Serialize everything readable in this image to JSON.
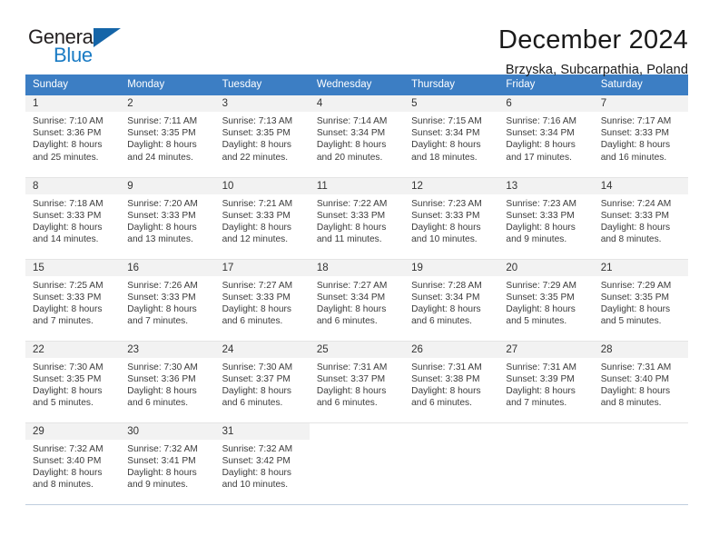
{
  "brand": {
    "name_part1": "General",
    "name_part2": "Blue",
    "triangle_color": "#1565a8",
    "blue_color": "#1a7bc4"
  },
  "header": {
    "title": "December 2024",
    "location": "Brzyska, Subcarpathia, Poland"
  },
  "theme": {
    "header_bg": "#3c7ec4",
    "daynum_bg": "#f2f2f2",
    "row_divider": "#e4e4e4",
    "table_rule": "#bfcede"
  },
  "weekday_headers": [
    "Sunday",
    "Monday",
    "Tuesday",
    "Wednesday",
    "Thursday",
    "Friday",
    "Saturday"
  ],
  "weeks": [
    [
      {
        "day": "1",
        "sunrise": "Sunrise: 7:10 AM",
        "sunset": "Sunset: 3:36 PM",
        "daylight1": "Daylight: 8 hours",
        "daylight2": "and 25 minutes."
      },
      {
        "day": "2",
        "sunrise": "Sunrise: 7:11 AM",
        "sunset": "Sunset: 3:35 PM",
        "daylight1": "Daylight: 8 hours",
        "daylight2": "and 24 minutes."
      },
      {
        "day": "3",
        "sunrise": "Sunrise: 7:13 AM",
        "sunset": "Sunset: 3:35 PM",
        "daylight1": "Daylight: 8 hours",
        "daylight2": "and 22 minutes."
      },
      {
        "day": "4",
        "sunrise": "Sunrise: 7:14 AM",
        "sunset": "Sunset: 3:34 PM",
        "daylight1": "Daylight: 8 hours",
        "daylight2": "and 20 minutes."
      },
      {
        "day": "5",
        "sunrise": "Sunrise: 7:15 AM",
        "sunset": "Sunset: 3:34 PM",
        "daylight1": "Daylight: 8 hours",
        "daylight2": "and 18 minutes."
      },
      {
        "day": "6",
        "sunrise": "Sunrise: 7:16 AM",
        "sunset": "Sunset: 3:34 PM",
        "daylight1": "Daylight: 8 hours",
        "daylight2": "and 17 minutes."
      },
      {
        "day": "7",
        "sunrise": "Sunrise: 7:17 AM",
        "sunset": "Sunset: 3:33 PM",
        "daylight1": "Daylight: 8 hours",
        "daylight2": "and 16 minutes."
      }
    ],
    [
      {
        "day": "8",
        "sunrise": "Sunrise: 7:18 AM",
        "sunset": "Sunset: 3:33 PM",
        "daylight1": "Daylight: 8 hours",
        "daylight2": "and 14 minutes."
      },
      {
        "day": "9",
        "sunrise": "Sunrise: 7:20 AM",
        "sunset": "Sunset: 3:33 PM",
        "daylight1": "Daylight: 8 hours",
        "daylight2": "and 13 minutes."
      },
      {
        "day": "10",
        "sunrise": "Sunrise: 7:21 AM",
        "sunset": "Sunset: 3:33 PM",
        "daylight1": "Daylight: 8 hours",
        "daylight2": "and 12 minutes."
      },
      {
        "day": "11",
        "sunrise": "Sunrise: 7:22 AM",
        "sunset": "Sunset: 3:33 PM",
        "daylight1": "Daylight: 8 hours",
        "daylight2": "and 11 minutes."
      },
      {
        "day": "12",
        "sunrise": "Sunrise: 7:23 AM",
        "sunset": "Sunset: 3:33 PM",
        "daylight1": "Daylight: 8 hours",
        "daylight2": "and 10 minutes."
      },
      {
        "day": "13",
        "sunrise": "Sunrise: 7:23 AM",
        "sunset": "Sunset: 3:33 PM",
        "daylight1": "Daylight: 8 hours",
        "daylight2": "and 9 minutes."
      },
      {
        "day": "14",
        "sunrise": "Sunrise: 7:24 AM",
        "sunset": "Sunset: 3:33 PM",
        "daylight1": "Daylight: 8 hours",
        "daylight2": "and 8 minutes."
      }
    ],
    [
      {
        "day": "15",
        "sunrise": "Sunrise: 7:25 AM",
        "sunset": "Sunset: 3:33 PM",
        "daylight1": "Daylight: 8 hours",
        "daylight2": "and 7 minutes."
      },
      {
        "day": "16",
        "sunrise": "Sunrise: 7:26 AM",
        "sunset": "Sunset: 3:33 PM",
        "daylight1": "Daylight: 8 hours",
        "daylight2": "and 7 minutes."
      },
      {
        "day": "17",
        "sunrise": "Sunrise: 7:27 AM",
        "sunset": "Sunset: 3:33 PM",
        "daylight1": "Daylight: 8 hours",
        "daylight2": "and 6 minutes."
      },
      {
        "day": "18",
        "sunrise": "Sunrise: 7:27 AM",
        "sunset": "Sunset: 3:34 PM",
        "daylight1": "Daylight: 8 hours",
        "daylight2": "and 6 minutes."
      },
      {
        "day": "19",
        "sunrise": "Sunrise: 7:28 AM",
        "sunset": "Sunset: 3:34 PM",
        "daylight1": "Daylight: 8 hours",
        "daylight2": "and 6 minutes."
      },
      {
        "day": "20",
        "sunrise": "Sunrise: 7:29 AM",
        "sunset": "Sunset: 3:35 PM",
        "daylight1": "Daylight: 8 hours",
        "daylight2": "and 5 minutes."
      },
      {
        "day": "21",
        "sunrise": "Sunrise: 7:29 AM",
        "sunset": "Sunset: 3:35 PM",
        "daylight1": "Daylight: 8 hours",
        "daylight2": "and 5 minutes."
      }
    ],
    [
      {
        "day": "22",
        "sunrise": "Sunrise: 7:30 AM",
        "sunset": "Sunset: 3:35 PM",
        "daylight1": "Daylight: 8 hours",
        "daylight2": "and 5 minutes."
      },
      {
        "day": "23",
        "sunrise": "Sunrise: 7:30 AM",
        "sunset": "Sunset: 3:36 PM",
        "daylight1": "Daylight: 8 hours",
        "daylight2": "and 6 minutes."
      },
      {
        "day": "24",
        "sunrise": "Sunrise: 7:30 AM",
        "sunset": "Sunset: 3:37 PM",
        "daylight1": "Daylight: 8 hours",
        "daylight2": "and 6 minutes."
      },
      {
        "day": "25",
        "sunrise": "Sunrise: 7:31 AM",
        "sunset": "Sunset: 3:37 PM",
        "daylight1": "Daylight: 8 hours",
        "daylight2": "and 6 minutes."
      },
      {
        "day": "26",
        "sunrise": "Sunrise: 7:31 AM",
        "sunset": "Sunset: 3:38 PM",
        "daylight1": "Daylight: 8 hours",
        "daylight2": "and 6 minutes."
      },
      {
        "day": "27",
        "sunrise": "Sunrise: 7:31 AM",
        "sunset": "Sunset: 3:39 PM",
        "daylight1": "Daylight: 8 hours",
        "daylight2": "and 7 minutes."
      },
      {
        "day": "28",
        "sunrise": "Sunrise: 7:31 AM",
        "sunset": "Sunset: 3:40 PM",
        "daylight1": "Daylight: 8 hours",
        "daylight2": "and 8 minutes."
      }
    ],
    [
      {
        "day": "29",
        "sunrise": "Sunrise: 7:32 AM",
        "sunset": "Sunset: 3:40 PM",
        "daylight1": "Daylight: 8 hours",
        "daylight2": "and 8 minutes."
      },
      {
        "day": "30",
        "sunrise": "Sunrise: 7:32 AM",
        "sunset": "Sunset: 3:41 PM",
        "daylight1": "Daylight: 8 hours",
        "daylight2": "and 9 minutes."
      },
      {
        "day": "31",
        "sunrise": "Sunrise: 7:32 AM",
        "sunset": "Sunset: 3:42 PM",
        "daylight1": "Daylight: 8 hours",
        "daylight2": "and 10 minutes."
      },
      {
        "day": "",
        "sunrise": "",
        "sunset": "",
        "daylight1": "",
        "daylight2": ""
      },
      {
        "day": "",
        "sunrise": "",
        "sunset": "",
        "daylight1": "",
        "daylight2": ""
      },
      {
        "day": "",
        "sunrise": "",
        "sunset": "",
        "daylight1": "",
        "daylight2": ""
      },
      {
        "day": "",
        "sunrise": "",
        "sunset": "",
        "daylight1": "",
        "daylight2": ""
      }
    ]
  ]
}
